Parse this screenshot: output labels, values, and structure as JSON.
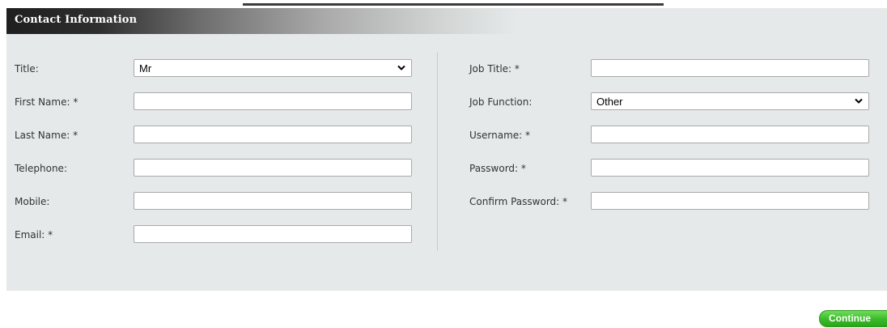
{
  "panel": {
    "title": "Contact Information"
  },
  "left_fields": [
    {
      "label": "Title:",
      "type": "select",
      "value": "Mr"
    },
    {
      "label": "First Name: *",
      "type": "text",
      "value": ""
    },
    {
      "label": "Last Name: *",
      "type": "text",
      "value": ""
    },
    {
      "label": "Telephone:",
      "type": "text",
      "value": ""
    },
    {
      "label": "Mobile:",
      "type": "text",
      "value": ""
    },
    {
      "label": "Email: *",
      "type": "text",
      "value": ""
    }
  ],
  "right_fields": [
    {
      "label": "Job Title: *",
      "type": "text",
      "value": ""
    },
    {
      "label": "Job Function:",
      "type": "select",
      "value": "Other"
    },
    {
      "label": "Username: *",
      "type": "text",
      "value": ""
    },
    {
      "label": "Password: *",
      "type": "text",
      "value": ""
    },
    {
      "label": "Confirm Password: *",
      "type": "text",
      "value": ""
    }
  ],
  "actions": {
    "continue_label": "Continue"
  },
  "colors": {
    "panel_background": "#e6e9e9",
    "header_dark": "#1f1f1f",
    "button_green": "#3cbd2a"
  }
}
